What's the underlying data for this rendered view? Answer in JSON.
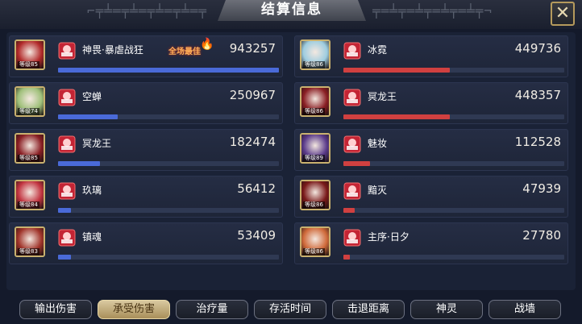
{
  "header": {
    "title": "结算信息"
  },
  "mvp_label": "全场最佳",
  "left_team": {
    "bar_color": "#4a6ad8",
    "players": [
      {
        "name": "神畏·暴虐战狂",
        "level": "85",
        "value": "943257",
        "fraction": 1.0,
        "mvp": true,
        "portrait_color": "#b22a2a"
      },
      {
        "name": "空蝉",
        "level": "74",
        "value": "250967",
        "fraction": 0.27,
        "mvp": false,
        "portrait_color": "#9fc07a"
      },
      {
        "name": "冥龙王",
        "level": "85",
        "value": "182474",
        "fraction": 0.19,
        "mvp": false,
        "portrait_color": "#8a1f24"
      },
      {
        "name": "玖璃",
        "level": "84",
        "value": "56412",
        "fraction": 0.06,
        "mvp": false,
        "portrait_color": "#c23440"
      },
      {
        "name": "镇魂",
        "level": "83",
        "value": "53409",
        "fraction": 0.06,
        "mvp": false,
        "portrait_color": "#a0342a"
      }
    ]
  },
  "right_team": {
    "bar_color": "#d04040",
    "players": [
      {
        "name": "冰霓",
        "level": "86",
        "value": "449736",
        "fraction": 0.48,
        "portrait_color": "#9ecde0"
      },
      {
        "name": "冥龙王",
        "level": "86",
        "value": "448357",
        "fraction": 0.48,
        "portrait_color": "#8a1f24"
      },
      {
        "name": "魅妆",
        "level": "89",
        "value": "112528",
        "fraction": 0.12,
        "portrait_color": "#5a3a8a"
      },
      {
        "name": "黯灭",
        "level": "86",
        "value": "47939",
        "fraction": 0.05,
        "portrait_color": "#7a1a1a"
      },
      {
        "name": "主序·日夕",
        "level": "86",
        "value": "27780",
        "fraction": 0.03,
        "portrait_color": "#d06a3a"
      }
    ]
  },
  "tabs": [
    {
      "label": "输出伤害",
      "active": false
    },
    {
      "label": "承受伤害",
      "active": true
    },
    {
      "label": "治疗量",
      "active": false
    },
    {
      "label": "存活时间",
      "active": false
    },
    {
      "label": "击退距离",
      "active": false
    },
    {
      "label": "神灵",
      "active": false
    },
    {
      "label": "战墙",
      "active": false
    }
  ]
}
